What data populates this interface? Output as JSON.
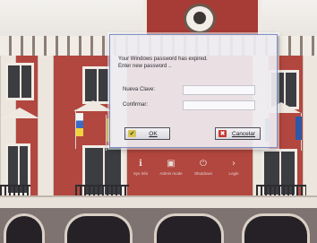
{
  "dialog": {
    "message_line1": "Your Windows password has expired.",
    "message_line2": "Enter new password ..",
    "new_password_label": "Nueva Clave:",
    "confirm_label": "Confirmar:",
    "new_password_value": "",
    "confirm_value": "",
    "ok_label": "OK",
    "cancel_label": "Cancelar",
    "ok_icon": "check-icon",
    "cancel_icon": "cancel-x-icon"
  },
  "bottom_bar": {
    "items": [
      {
        "label": "Sys Info",
        "icon": "info-icon"
      },
      {
        "label": "Admin mode",
        "icon": "lock-icon"
      },
      {
        "label": "Shutdown",
        "icon": "power-icon"
      },
      {
        "label": "Login",
        "icon": "chevron-right-icon"
      }
    ]
  }
}
